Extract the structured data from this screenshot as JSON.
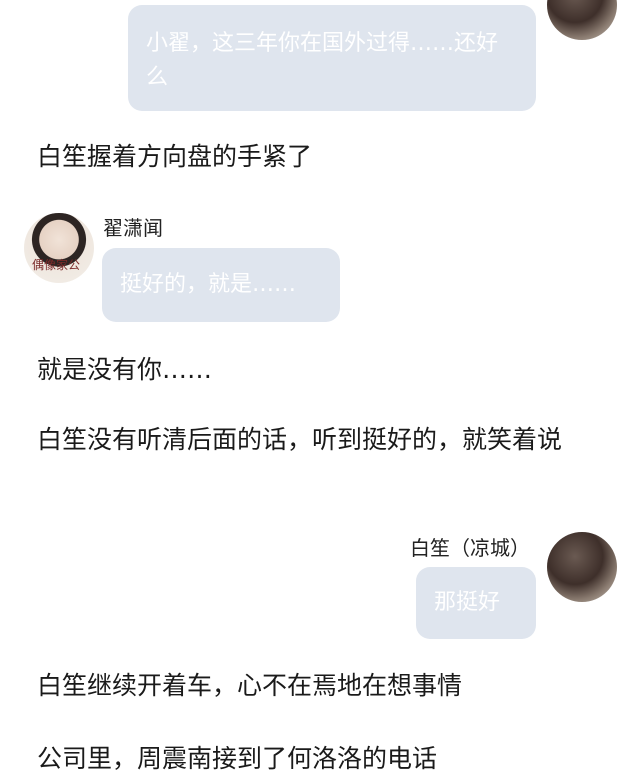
{
  "messages": {
    "m1": {
      "text": "小翟，这三年你在国外过得……还好么"
    },
    "m2": {
      "sender": "翟潇闻",
      "text": "挺好的，就是……"
    },
    "m3": {
      "sender": "白笙（凉城）",
      "text": "那挺好"
    }
  },
  "paragraphs": {
    "p1": "白笙握着方向盘的手紧了",
    "p2": "就是没有你……",
    "p3": "白笙没有听清后面的话，听到挺好的，就笑着说",
    "p4": "白笙继续开着车，心不在焉地在想事情",
    "p5": "公司里，周震南接到了何洛洛的电话"
  },
  "avatars": {
    "zhai_scribble": "偶像家公"
  },
  "colors": {
    "bubble": "#dfe5ee",
    "bubble_text": "#ffffff",
    "body_text": "#1a1a1a"
  }
}
